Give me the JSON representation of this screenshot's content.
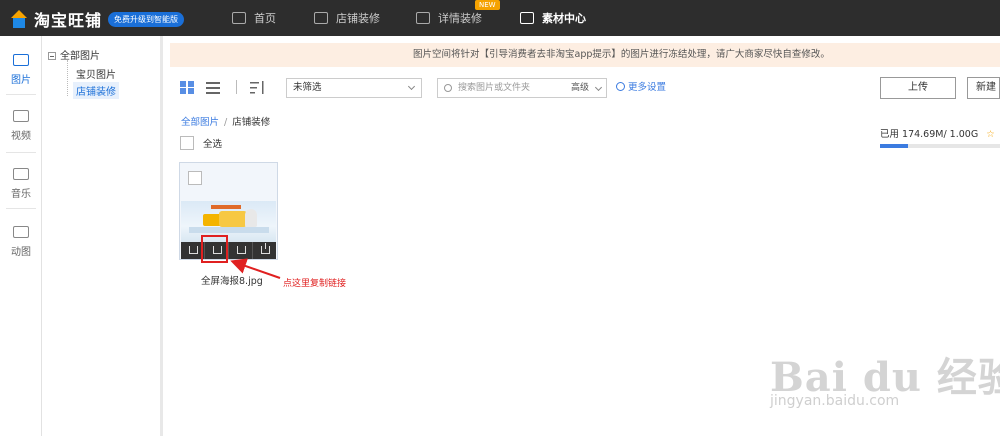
{
  "brand": {
    "name": "淘宝旺铺",
    "upgrade_badge": "免费升级到智能版"
  },
  "nav": {
    "home": "首页",
    "decor": "店铺装修",
    "detail": "详情装修",
    "new_tag": "NEW",
    "material": "素材中心"
  },
  "rail": {
    "images": "图片",
    "video": "视频",
    "music": "音乐",
    "animated": "动图"
  },
  "tree": {
    "root": "全部图片",
    "children": [
      "宝贝图片",
      "店铺装修"
    ]
  },
  "notice": "图片空间将针对【引导消费者去非淘宝app提示】的图片进行冻结处理，请广大商家尽快自查修改。",
  "toolbar": {
    "filter_value": "未筛选",
    "search_placeholder": "搜索图片或文件夹",
    "advanced": "高级",
    "more_settings": "更多设置",
    "upload": "上传",
    "new_folder": "新建"
  },
  "breadcrumb": {
    "root": "全部图片",
    "separator": "/",
    "current": "店铺装修"
  },
  "select_all": "全选",
  "usage": {
    "text": "已用 174.69M/ 1.00G",
    "used_fraction": 0.23
  },
  "file": {
    "name": "全屏海报8.jpg"
  },
  "annotation": "点这里复制链接",
  "watermark": {
    "logo": "Bai du 经验",
    "url": "jingyan.baidu.com"
  },
  "colors": {
    "accent": "#3b7be0",
    "annotation_red": "#e02020",
    "topbar": "#2d2d2d",
    "notice_bg": "#fdeee2"
  }
}
